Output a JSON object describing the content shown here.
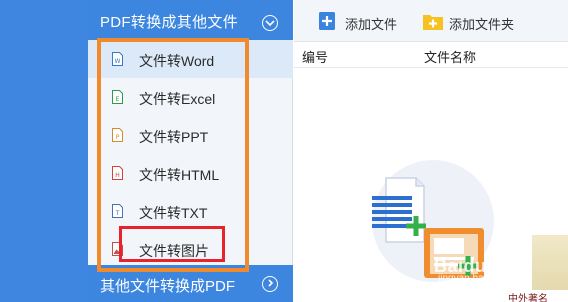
{
  "sidebar": {
    "header_title": "PDF转换成其他文件",
    "items": [
      {
        "label": "文件转Word",
        "icon": "word-file-icon",
        "icon_color": "#3a78c9",
        "letter": "W"
      },
      {
        "label": "文件转Excel",
        "icon": "excel-file-icon",
        "icon_color": "#2f9a4a",
        "letter": "E"
      },
      {
        "label": "文件转PPT",
        "icon": "ppt-file-icon",
        "icon_color": "#d58a2c",
        "letter": "P"
      },
      {
        "label": "文件转HTML",
        "icon": "html-file-icon",
        "icon_color": "#d0443a",
        "letter": "H"
      },
      {
        "label": "文件转TXT",
        "icon": "txt-file-icon",
        "icon_color": "#4a6fb5",
        "letter": "T"
      },
      {
        "label": "文件转图片",
        "icon": "image-file-icon",
        "icon_color": "#c0504d",
        "letter": ""
      }
    ],
    "footer_title": "其他文件转换成PDF"
  },
  "toolbar": {
    "add_file_label": "添加文件",
    "add_folder_label": "添加文件夹"
  },
  "table": {
    "columns": [
      "编号",
      "文件名称"
    ]
  },
  "watermark": {
    "main": "Baidu 经验",
    "sub": "jingyan.baidu.com"
  },
  "corner_text": "中外著名",
  "colors": {
    "accent_blue": "#3c86e0",
    "highlight_orange": "#f08a2c",
    "highlight_red": "#e8232a"
  }
}
